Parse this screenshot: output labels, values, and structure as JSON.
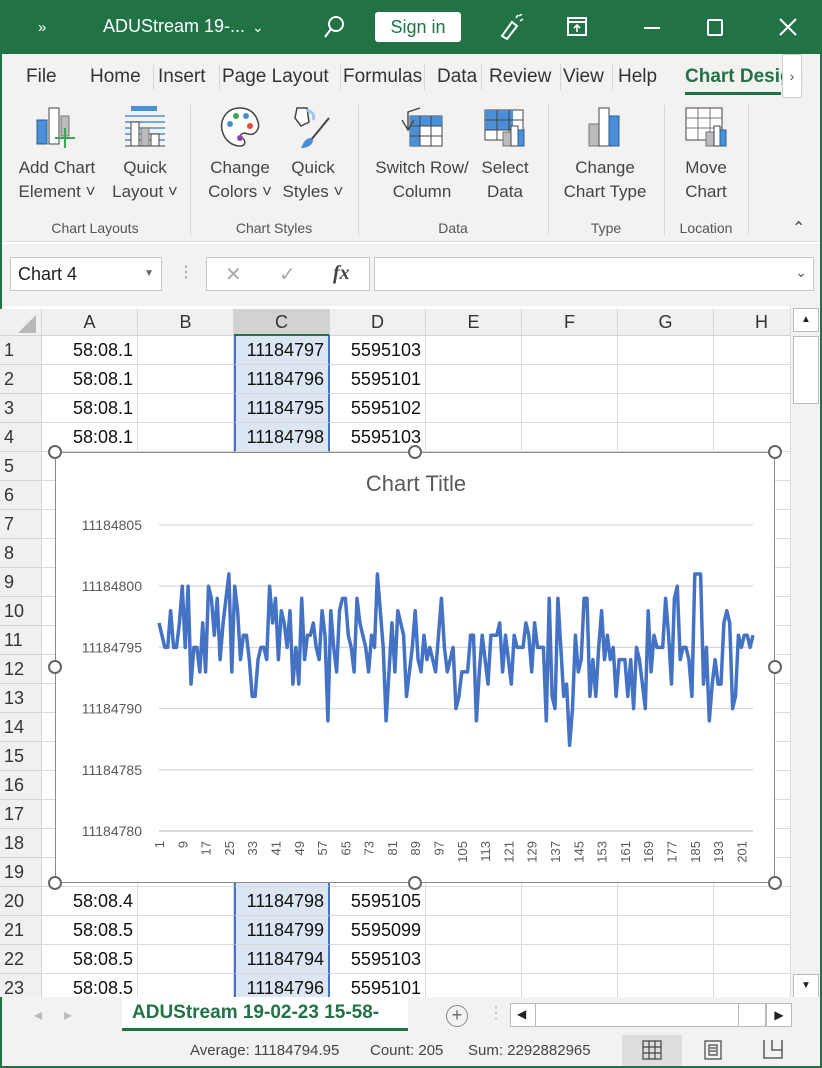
{
  "titlebar": {
    "overflow_icon": "»",
    "filename": "ADUStream 19-...",
    "sign_in": "Sign in",
    "colors": {
      "brand": "#217346"
    }
  },
  "tabs": [
    "File",
    "Home",
    "Insert",
    "Page Layout",
    "Formulas",
    "Data",
    "Review",
    "View",
    "Help",
    "Chart Design"
  ],
  "active_tab": "Chart Design",
  "ribbon": {
    "buttons": [
      {
        "line1": "Add Chart",
        "line2": "Element ˅",
        "icon": "add-chart-element-icon"
      },
      {
        "line1": "Quick",
        "line2": "Layout ˅",
        "icon": "quick-layout-icon"
      },
      {
        "line1": "Change",
        "line2": "Colors ˅",
        "icon": "palette-icon"
      },
      {
        "line1": "Quick",
        "line2": "Styles ˅",
        "icon": "paint-brush-icon"
      },
      {
        "line1": "Switch Row/",
        "line2": "Column",
        "icon": "switch-row-column-icon"
      },
      {
        "line1": "Select",
        "line2": "Data",
        "icon": "select-data-icon"
      },
      {
        "line1": "Change",
        "line2": "Chart Type",
        "icon": "change-chart-type-icon"
      },
      {
        "line1": "Move",
        "line2": "Chart",
        "icon": "move-chart-icon"
      }
    ],
    "groups": [
      "Chart Layouts",
      "Chart Styles",
      "Data",
      "Type",
      "Location"
    ]
  },
  "formula_bar": {
    "name_box": "Chart 4",
    "cancel": "✕",
    "enter": "✓",
    "fx": "fx",
    "formula": ""
  },
  "columns": [
    "A",
    "B",
    "C",
    "D",
    "E",
    "F",
    "G",
    "H"
  ],
  "selected_column": "C",
  "rows": [
    {
      "n": "1",
      "A": "58:08.1",
      "C": "11184797",
      "D": "5595103"
    },
    {
      "n": "2",
      "A": "58:08.1",
      "C": "11184796",
      "D": "5595101"
    },
    {
      "n": "3",
      "A": "58:08.1",
      "C": "11184795",
      "D": "5595102"
    },
    {
      "n": "4",
      "A": "58:08.1",
      "C": "11184798",
      "D": "5595103"
    },
    {
      "n": "5"
    },
    {
      "n": "6"
    },
    {
      "n": "7"
    },
    {
      "n": "8"
    },
    {
      "n": "9"
    },
    {
      "n": "10"
    },
    {
      "n": "11"
    },
    {
      "n": "12"
    },
    {
      "n": "13"
    },
    {
      "n": "14"
    },
    {
      "n": "15"
    },
    {
      "n": "16"
    },
    {
      "n": "17"
    },
    {
      "n": "18"
    },
    {
      "n": "19"
    },
    {
      "n": "20",
      "A": "58:08.4",
      "C": "11184798",
      "D": "5595105"
    },
    {
      "n": "21",
      "A": "58:08.5",
      "C": "11184799",
      "D": "5595099"
    },
    {
      "n": "22",
      "A": "58:08.5",
      "C": "11184794",
      "D": "5595103"
    },
    {
      "n": "23",
      "A": "58:08.5",
      "C": "11184796",
      "D": "5595101"
    }
  ],
  "sheet_tab": "ADUStream 19-02-23 15-58-",
  "status": {
    "average": "Average: 11184794.95",
    "count": "Count: 205",
    "sum": "Sum: 2292882965"
  },
  "chart_data": {
    "type": "line",
    "title": "Chart Title",
    "xlabel": "",
    "ylabel": "",
    "ylim": [
      11184780,
      11184805
    ],
    "yticks": [
      11184805,
      11184800,
      11184795,
      11184790,
      11184785,
      11184780
    ],
    "x_tick_step": 8,
    "grid": true,
    "line_color": "#4472c4",
    "values": [
      11184797,
      11184796,
      11184795,
      11184795,
      11184798,
      11184795,
      11184795,
      11184797,
      11184800,
      11184795,
      11184800,
      11184792,
      11184795,
      11184795,
      11184793,
      11184797,
      11184793,
      11184800,
      11184799,
      11184796,
      11184799,
      11184794,
      11184797,
      11184799,
      11184801,
      11184793,
      11184800,
      11184798,
      11184794,
      11184796,
      11184796,
      11184794,
      11184791,
      11184791,
      11184794,
      11184795,
      11184795,
      11184794,
      11184800,
      11184797,
      11184799,
      11184794,
      11184798,
      11184797,
      11184795,
      11184798,
      11184792,
      11184795,
      11184792,
      11184799,
      11184794,
      11184796,
      11184796,
      11184797,
      11184795,
      11184794,
      11184798,
      11184796,
      11184789,
      11184798,
      11184795,
      11184793,
      11184798,
      11184799,
      11184799,
      11184796,
      11184795,
      11184793,
      11184799,
      11184797,
      11184796,
      11184795,
      11184793,
      11184796,
      11184795,
      11184801,
      11184798,
      11184795,
      11184789,
      11184793,
      11184797,
      11184793,
      11184798,
      11184797,
      11184796,
      11184791,
      11184793,
      11184795,
      11184798,
      11184794,
      11184793,
      11184796,
      11184794,
      11184795,
      11184794,
      11184793,
      11184796,
      11184799,
      11184795,
      11184793,
      11184794,
      11184795,
      11184790,
      11184791,
      11184793,
      11184793,
      11184793,
      11184796,
      11184796,
      11184789,
      11184793,
      11184796,
      11184794,
      11184792,
      11184796,
      11184796,
      11184796,
      11184797,
      11184793,
      11184796,
      11184794,
      11184792,
      11184796,
      11184795,
      11184795,
      11184795,
      11184797,
      11184796,
      11184793,
      11184797,
      11184795,
      11184795,
      11184795,
      11184789,
      11184799,
      11184791,
      11184790,
      11184799,
      11184795,
      11184791,
      11184792,
      11184787,
      11184790,
      11184796,
      11184793,
      11184794,
      11184799,
      11184799,
      11184791,
      11184794,
      11184791,
      11184795,
      11184798,
      11184794,
      11184796,
      11184794,
      11184795,
      11184791,
      11184794,
      11184794,
      11184794,
      11184791,
      11184794,
      11184790,
      11184795,
      11184794,
      11184792,
      11184790,
      11184798,
      11184793,
      11184796,
      11184795,
      11184795,
      11184795,
      11184799,
      11184796,
      11184792,
      11184799,
      11184800,
      11184794,
      11184795,
      11184795,
      11184794,
      11184791,
      11184801,
      11184801,
      11184801,
      11184792,
      11184795,
      11184789,
      11184792,
      11184794,
      11184792,
      11184792,
      11184797,
      11184798,
      11184797,
      11184790,
      11184791,
      11184796,
      11184795,
      11184796,
      11184796,
      11184795,
      11184796
    ]
  }
}
